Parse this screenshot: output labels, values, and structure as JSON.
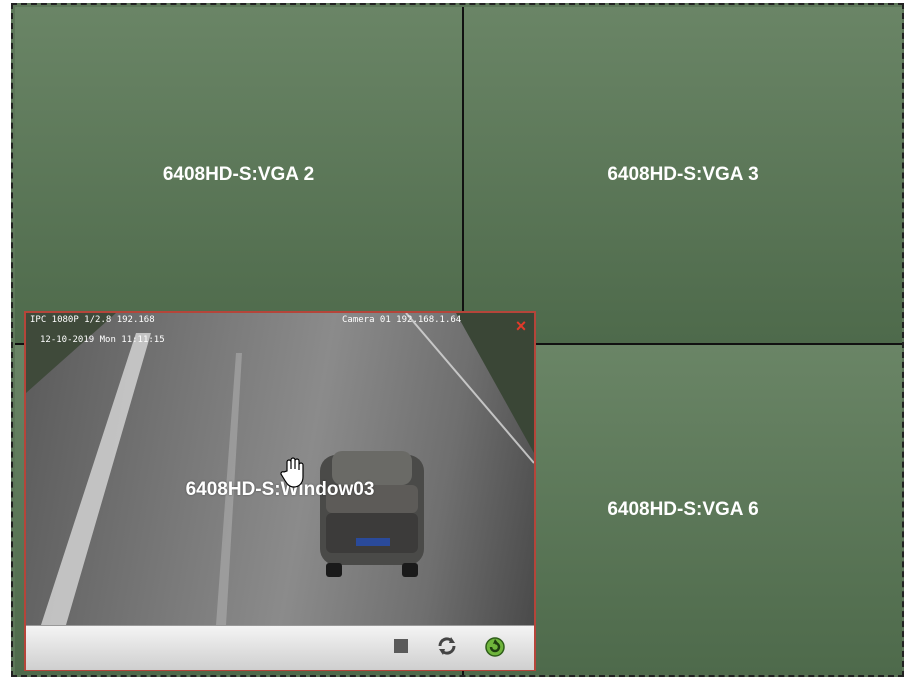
{
  "cells": {
    "vga2": "6408HD-S:VGA 2",
    "vga3": "6408HD-S:VGA 3",
    "vga5": "",
    "vga6": "6408HD-S:VGA 6"
  },
  "window": {
    "title": "6408HD-S:Window03",
    "osd_top_left": "IPC 1080P 1/2.8 192.168",
    "osd_timestamp": "12-10-2019 Mon 11:11:15",
    "osd_top_right": "Camera 01 192.168.1.64",
    "close_label": "×"
  },
  "toolbar": {
    "stop": "stop-icon",
    "refresh": "refresh-icon",
    "rotate": "rotate-icon"
  },
  "colors": {
    "cell_green": "#5c7658",
    "window_border": "#b5453a",
    "close_red": "#e23a2a"
  }
}
